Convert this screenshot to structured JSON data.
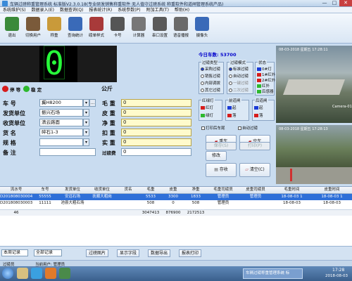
{
  "window": {
    "title": "车辆过磅称重管理系统 标准版V2.3.0.18(专业研发销售称重软件 无人值守过磅系统 称重软件和道闸管理系统产品)",
    "min": "—",
    "max": "□",
    "close": "✕"
  },
  "menu": [
    "系统维护(S)",
    "数据录入(E)",
    "数据查询(Q)",
    "报表统计(R)",
    "系统参数(P)",
    "附加工具(T)",
    "帮助(H)"
  ],
  "toolbar": [
    {
      "label": "退出",
      "icon": "exit-icon",
      "color": "#3a8a3a"
    },
    {
      "label": "切换用户",
      "icon": "switch-user-icon",
      "color": "#7a5a3a"
    },
    {
      "label": "称重",
      "icon": "scale-icon",
      "color": "#c99a3a"
    },
    {
      "label": "查询统计",
      "icon": "query-icon",
      "color": "#3a6ab8"
    },
    {
      "label": "磅单样式",
      "icon": "ticket-style-icon",
      "color": "#a83a3a"
    },
    {
      "label": "卡号",
      "icon": "card-icon",
      "color": "#555555"
    },
    {
      "label": "计算器",
      "icon": "calculator-icon",
      "color": "#777777"
    },
    {
      "label": "串口设置",
      "icon": "serial-port-icon",
      "color": "#5a5a5a"
    },
    {
      "label": "语音播报",
      "icon": "voice-icon",
      "color": "#6a6a6a"
    },
    {
      "label": "摄像头",
      "icon": "camera-icon",
      "color": "#3a6ab8"
    }
  ],
  "display": {
    "weight": "0",
    "unit": "公斤"
  },
  "indicators": {
    "a": {
      "label": "停 等",
      "color": "#d61c1c"
    },
    "b": {
      "label": "稳 定",
      "color": "#2db82d"
    }
  },
  "form": [
    {
      "label": "车 号",
      "value": "冀H8200"
    },
    {
      "label": "发货单位",
      "value": "振兴石场"
    },
    {
      "label": "收货单位",
      "value": "清云路面"
    },
    {
      "label": "货 名",
      "value": "碎石1-3"
    },
    {
      "label": "规 格",
      "value": ""
    },
    {
      "label": "备 注",
      "value": ""
    }
  ],
  "weights": [
    {
      "label": "毛 重",
      "value": "0"
    },
    {
      "label": "皮 重",
      "value": "0"
    },
    {
      "label": "净 重",
      "value": "0"
    },
    {
      "label": "扣 重",
      "value": "0"
    },
    {
      "label": "实 重",
      "value": "0"
    },
    {
      "label": "过磅费",
      "value": "0"
    }
  ],
  "stats": {
    "today": "今日车数: 53700"
  },
  "group_type": {
    "title": "过磅类型",
    "options": [
      "采购过磅",
      "销售过磅",
      "内部调拨",
      "其它过磅"
    ],
    "selected": 0
  },
  "group_mode": {
    "title": "过磅模式",
    "options": [
      "标准过磅",
      "自动过磅",
      "一键过磅",
      "二次过磅"
    ],
    "selected": 0
  },
  "group_state": {
    "title": "状态",
    "items": [
      {
        "label": "0#灯",
        "color": "#1a3bd6"
      },
      {
        "label": "1#红外",
        "color": "#d61c1c"
      },
      {
        "label": "2#红外",
        "color": "#d61c1c"
      },
      {
        "label": "红外",
        "color": "#2db82d"
      },
      {
        "label": "后感器",
        "color": "#2db82d"
      }
    ]
  },
  "group_light": {
    "title": "红绿灯",
    "items": [
      {
        "label": "红灯",
        "color": "#d61c1c"
      },
      {
        "label": "绿灯",
        "color": "#2db82d"
      }
    ]
  },
  "group_gate1": {
    "title": "前道闸",
    "items": [
      {
        "label": "起",
        "color": "#1a3bd6"
      },
      {
        "label": "落",
        "color": "#d61c1c"
      }
    ]
  },
  "group_gate2": {
    "title": "后道闸",
    "items": [
      {
        "label": "起",
        "color": "#1a3bd6"
      },
      {
        "label": "落",
        "color": "#d61c1c"
      }
    ]
  },
  "checks": {
    "print": "打印后车尾",
    "auto": "自动过磅"
  },
  "actions": {
    "heavy": "重车",
    "empty": "空车",
    "modify": "修改",
    "save": "保存(S)",
    "print": "打印(P)",
    "stock": "存收",
    "clear": "清空(C)"
  },
  "cameras": [
    {
      "ts": "08-03-2018 星期五 17:28:11",
      "label": "Camera-01"
    },
    {
      "ts": "08-03-2018 星期五 17:28:13",
      "label": ""
    }
  ],
  "table": {
    "headers": [
      "流水号",
      "车号",
      "发货单位",
      "收货单位",
      "货名",
      "毛重",
      "皮重",
      "净重",
      "毛重司磅员",
      "皮重司磅员",
      "毛重时间",
      "皮重时间"
    ],
    "rows": [
      [
        "D201808030004",
        "55555",
        "安远石场",
        "抚顺大粗岗",
        "",
        "5533",
        "3300",
        "1833",
        "管理员",
        "管理员",
        "18-08-03 1",
        "18-08-03 1"
      ],
      [
        "D201808030003",
        "11111",
        "池县大粗石场",
        "",
        "",
        "508",
        "0",
        "508",
        "管理员",
        "",
        "18-08-03",
        "18-08-03"
      ]
    ],
    "footer": [
      "46",
      "",
      "",
      "",
      "",
      "3047413",
      "876900",
      "2172513",
      "",
      "",
      "",
      ""
    ]
  },
  "bottom": {
    "sel1": "本周记录",
    "sel2": "全部记录",
    "b1": "过磅图片",
    "b2": "显示字段",
    "b3": "数据导出",
    "b4": "报表打印"
  },
  "status": {
    "a": "过磅员",
    "b": "当前用户: 管理员",
    "c": "车辆过磅称重管理系统 标"
  },
  "clock": {
    "time": "17:28",
    "date": "2018-08-03"
  }
}
